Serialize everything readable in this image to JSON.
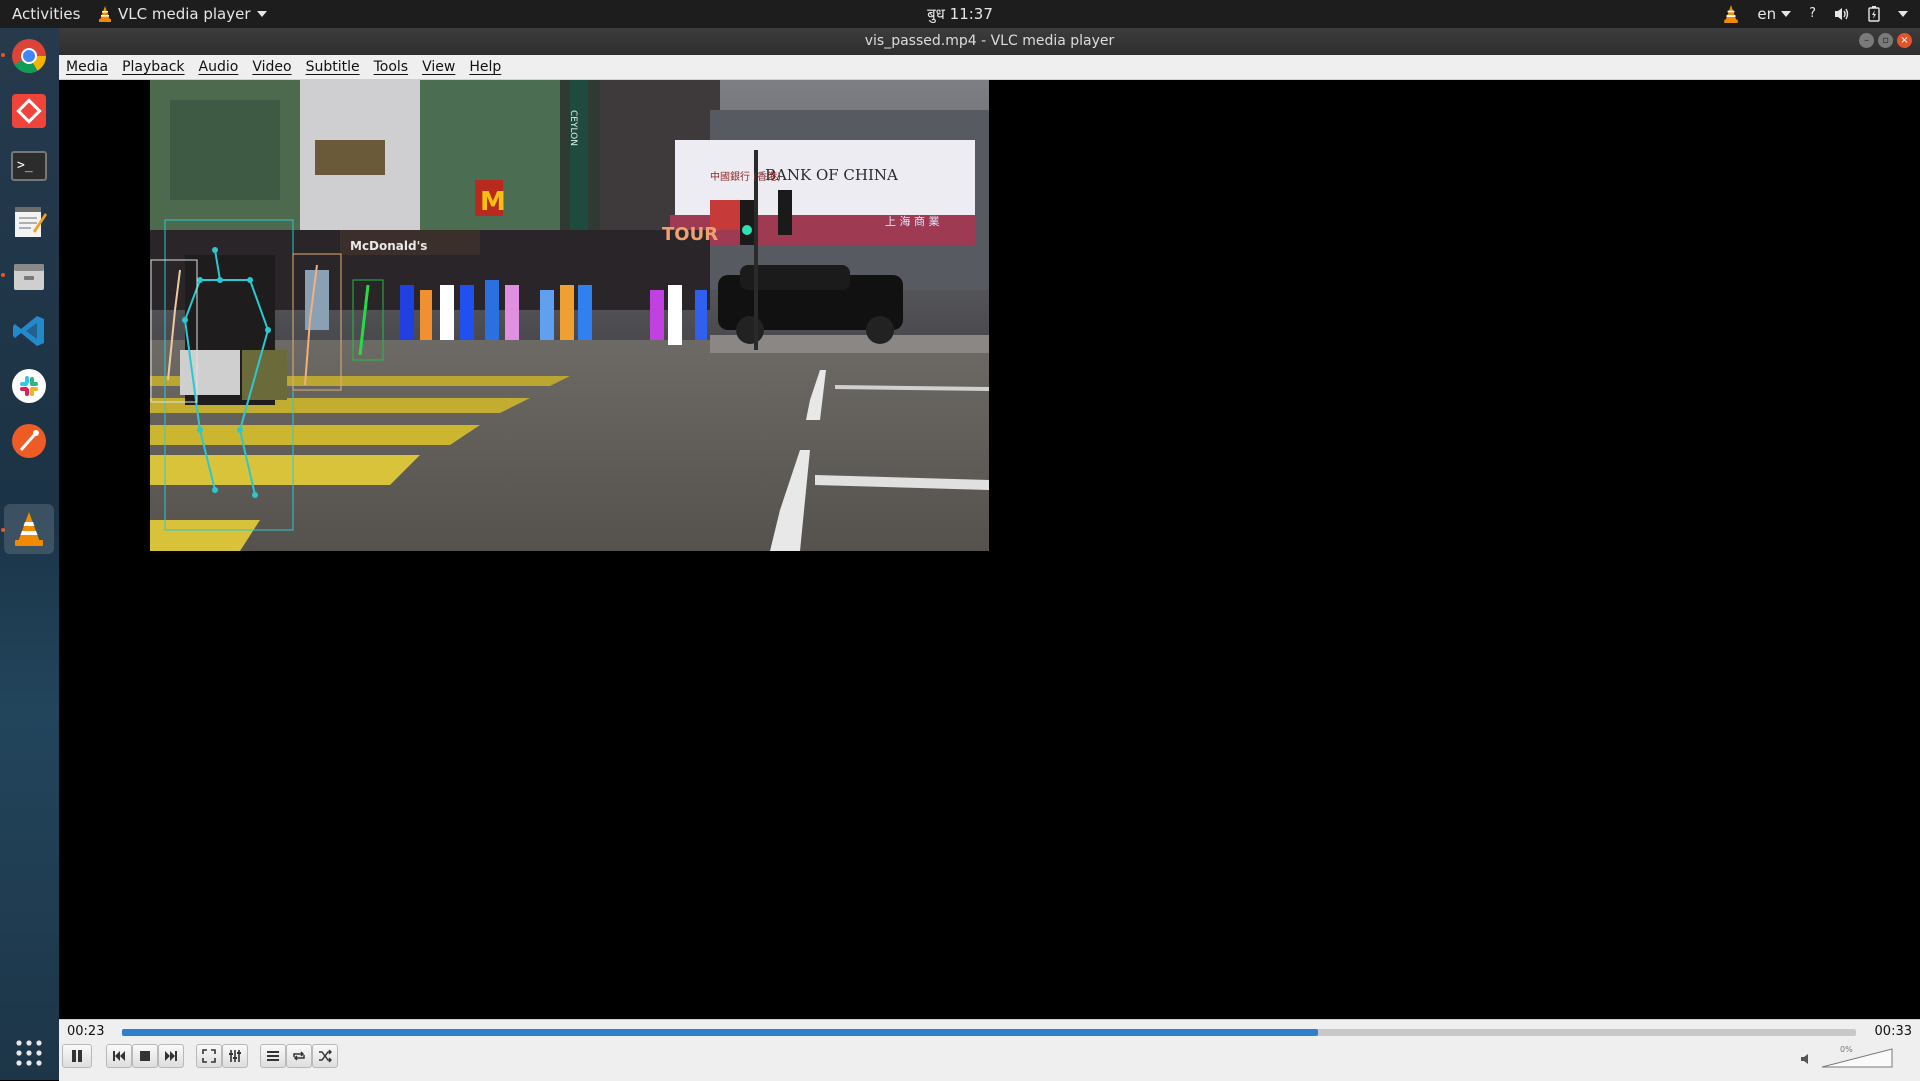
{
  "topbar": {
    "activities": "Activities",
    "app_menu": "VLC media player",
    "clock": "बुध 11:37",
    "lang": "en",
    "help_glyph": "?"
  },
  "dock": {
    "items": [
      {
        "name": "chrome-icon",
        "color": "#4285f4"
      },
      {
        "name": "anydesk-icon",
        "color": "#ef443b"
      },
      {
        "name": "terminal-icon",
        "color": "#2c2c2c"
      },
      {
        "name": "text-editor-icon",
        "color": "#e8e8e8"
      },
      {
        "name": "file-manager-icon",
        "color": "#c8c8c8"
      },
      {
        "name": "vscode-icon",
        "color": "#2489ca"
      },
      {
        "name": "slack-icon",
        "color": "#e01e5a"
      },
      {
        "name": "postman-icon",
        "color": "#ef5b25"
      },
      {
        "name": "vlc-icon",
        "color": "#f08a00"
      }
    ],
    "apps_grid_icon": "show-applications-icon"
  },
  "window": {
    "title": "vis_passed.mp4 - VLC media player"
  },
  "menubar": {
    "items": [
      "Media",
      "Playback",
      "Audio",
      "Video",
      "Subtitle",
      "Tools",
      "View",
      "Help"
    ]
  },
  "video": {
    "signs": {
      "bank": "BANK OF CHINA",
      "bank_cn": "中國銀行 (香港)",
      "mcdonalds": "McDonald's",
      "ceylon": "CEYLON",
      "tour": "TOUR",
      "shanghai": "上 海 商 業"
    }
  },
  "controls": {
    "elapsed": "00:23",
    "total": "00:33",
    "progress": 0.69,
    "volume_label": "0%",
    "volume_level": 0.0
  },
  "colors": {
    "accent": "#2e7fd0",
    "ubuntu_orange": "#e95420"
  }
}
